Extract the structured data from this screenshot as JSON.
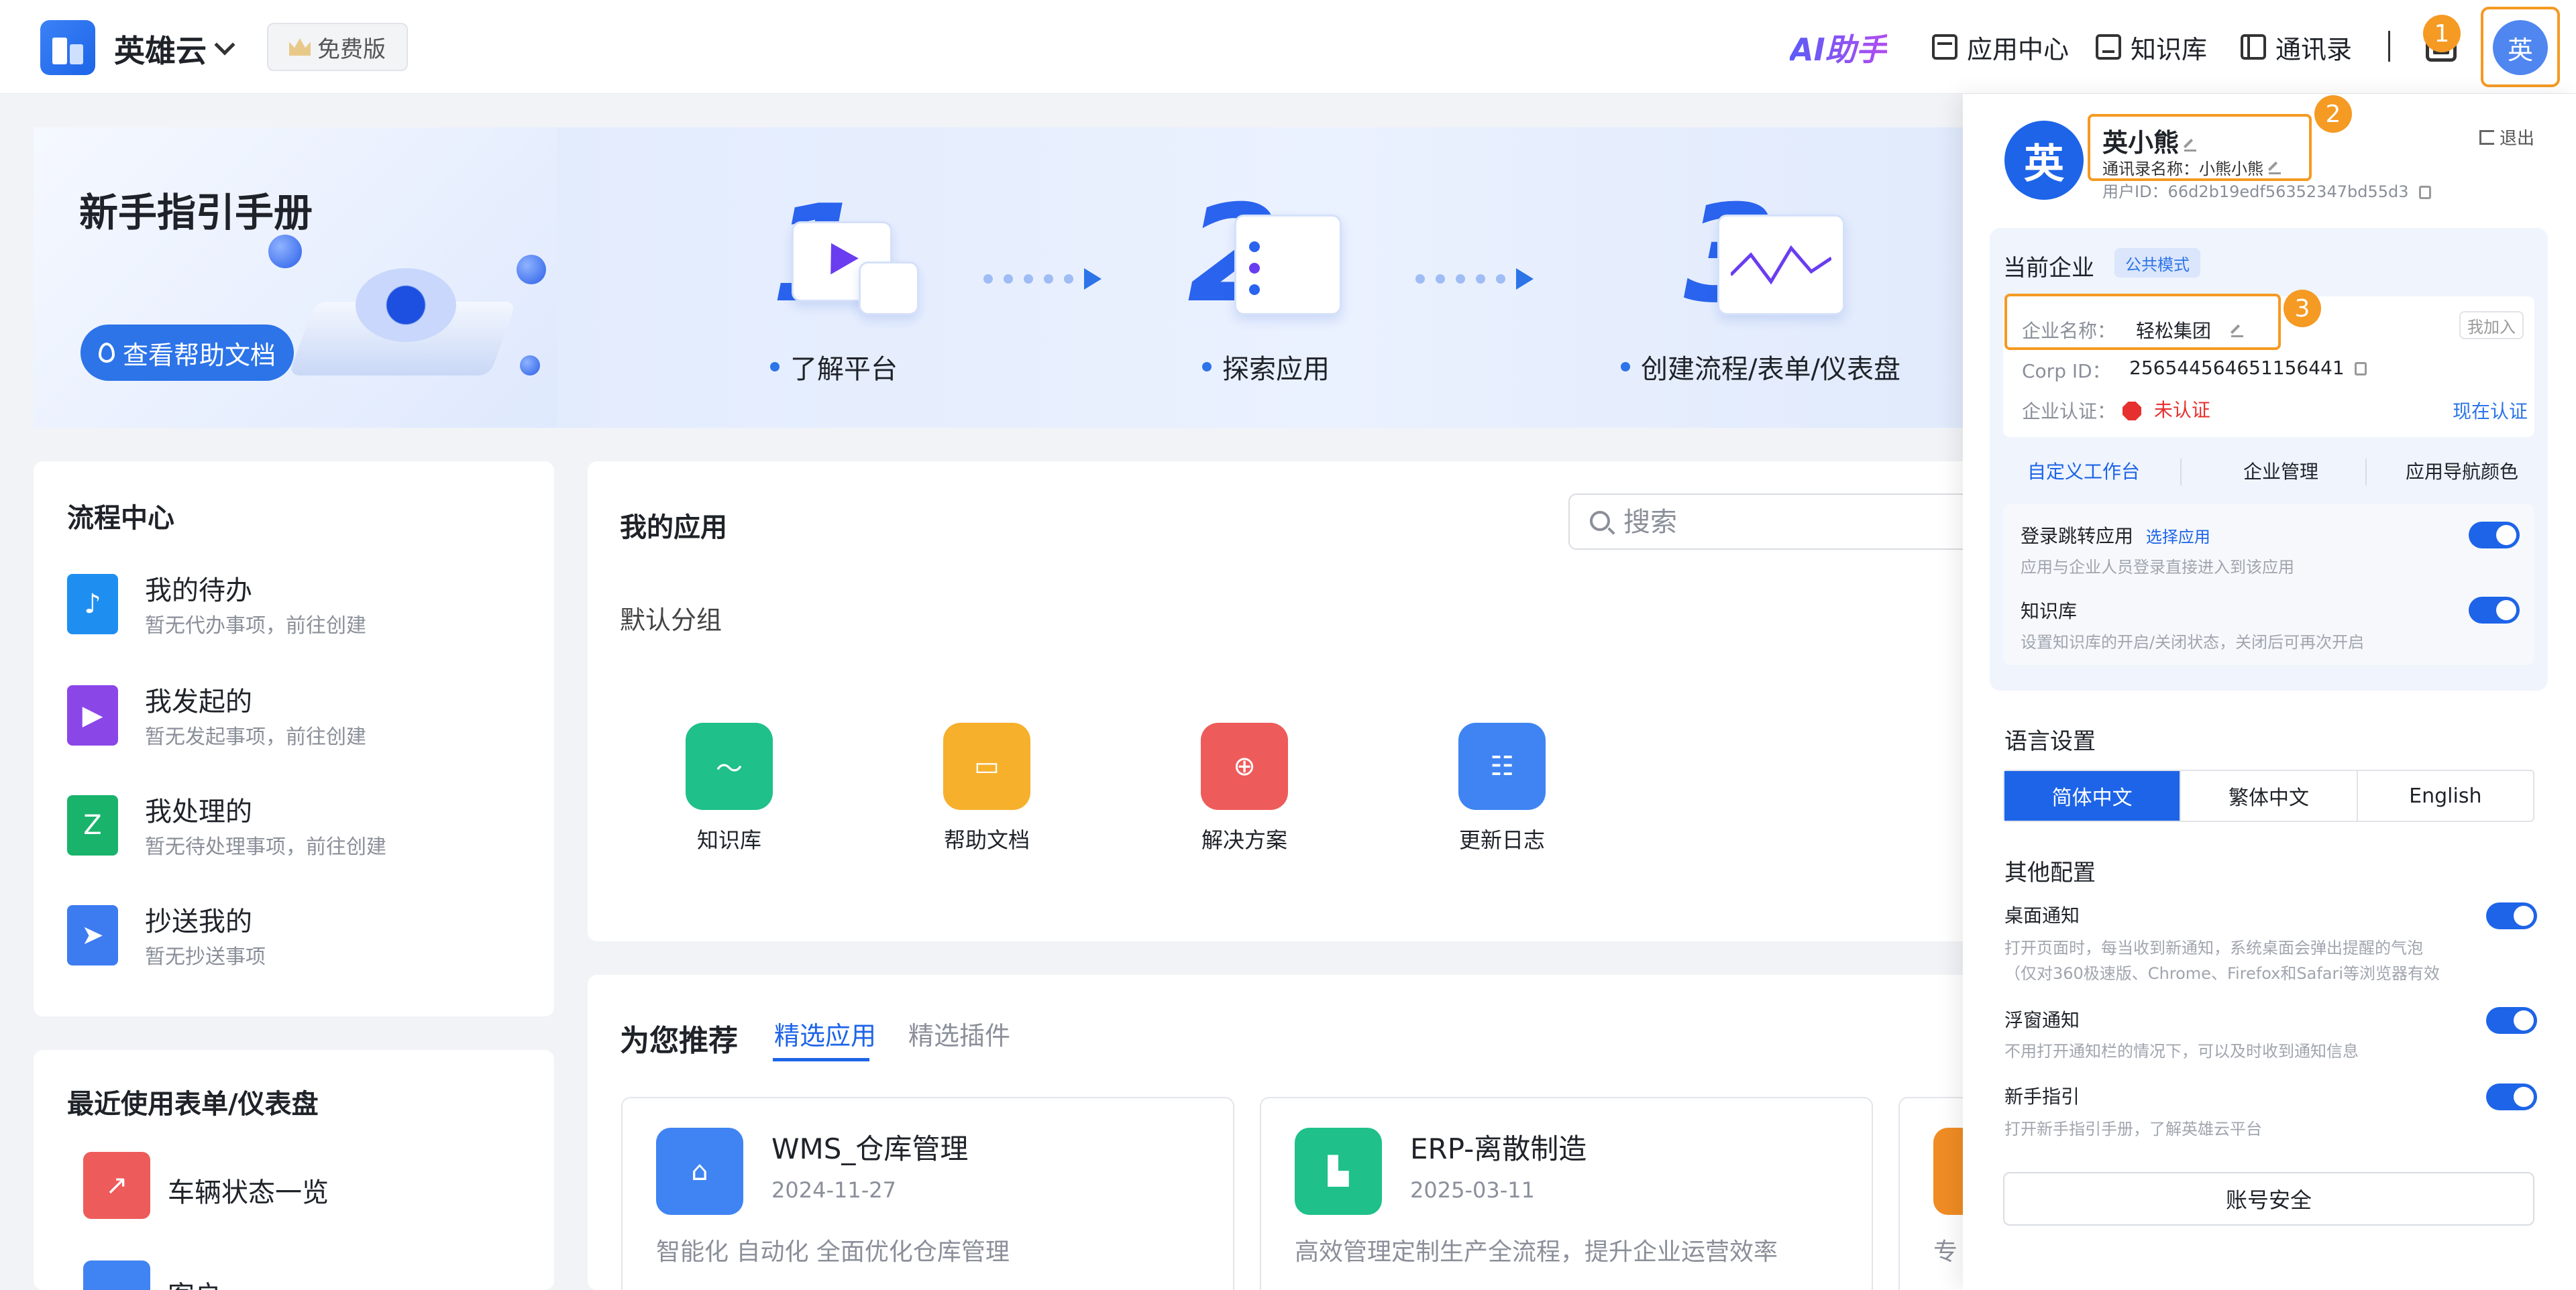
{
  "topbar": {
    "brand": "英雄云",
    "plan": "免费版",
    "ai": "AI助手",
    "nav": [
      "应用中心",
      "知识库",
      "通讯录"
    ],
    "avatar_char": "英",
    "badges": [
      "1",
      "2",
      "3"
    ]
  },
  "banner": {
    "title": "新手指引手册",
    "help_button": "查看帮助文档",
    "steps": [
      "了解平台",
      "探索应用",
      "创建流程/表单/仪表盘"
    ],
    "step_numbers": [
      "1",
      "2",
      "3"
    ]
  },
  "flow": {
    "title": "流程中心",
    "items": [
      {
        "name": "我的待办",
        "sub": "暂无代办事项，前往创建",
        "color": "#1e8ff0"
      },
      {
        "name": "我发起的",
        "sub": "暂无发起事项，前往创建",
        "color": "#8b46e8"
      },
      {
        "name": "我处理的",
        "sub": "暂无待处理事项，前往创建",
        "color": "#19b36b"
      },
      {
        "name": "抄送我的",
        "sub": "暂无抄送事项",
        "color": "#3d7bf0"
      }
    ]
  },
  "recent": {
    "title": "最近使用表单/仪表盘",
    "items": [
      "车辆状态一览",
      "客户"
    ]
  },
  "myapps": {
    "title": "我的应用",
    "search_placeholder": "搜索",
    "group": "默认分组",
    "apps": [
      {
        "name": "知识库",
        "color": "#1fc08a"
      },
      {
        "name": "帮助文档",
        "color": "#f6b02c"
      },
      {
        "name": "解决方案",
        "color": "#ee5b5b"
      },
      {
        "name": "更新日志",
        "color": "#3f84f2"
      }
    ]
  },
  "recommend": {
    "title": "为您推荐",
    "tabs": [
      "精选应用",
      "精选插件"
    ],
    "cards": [
      {
        "name": "WMS_仓库管理",
        "date": "2024-11-27",
        "desc": "智能化 自动化 全面优化仓库管理",
        "color": "#3f84f2"
      },
      {
        "name": "ERP-离散制造",
        "date": "2025-03-11",
        "desc": "高效管理定制生产全流程，提升企业运营效率",
        "color": "#1fc08a"
      },
      {
        "name": "",
        "date": "",
        "desc": "专",
        "color": "#f08c24"
      }
    ]
  },
  "drawer": {
    "avatar_char": "英",
    "name": "英小熊",
    "contact_name": "通讯录名称：小熊小熊",
    "user_id": "用户ID：66d2b19edf56352347bd55d3",
    "logout": "退出",
    "corp": {
      "title": "当前企业",
      "mode": "公共模式",
      "name_label": "企业名称：",
      "name": "轻松集团",
      "join": "我加入",
      "corp_id_label": "Corp ID：",
      "corp_id": "256544564651156441",
      "auth_label": "企业认证：",
      "auth_status": "未认证",
      "auth_link": "现在认证",
      "tabs": [
        "自定义工作台",
        "企业管理",
        "应用导航颜色"
      ],
      "toggles": [
        {
          "label": "登录跳转应用",
          "link": "选择应用",
          "sub": "应用与企业人员登录直接进入到该应用"
        },
        {
          "label": "知识库",
          "link": "",
          "sub": "设置知识库的开启/关闭状态，关闭后可再次开启"
        }
      ]
    },
    "language": {
      "title": "语言设置",
      "options": [
        "简体中文",
        "繁体中文",
        "English"
      ]
    },
    "other": {
      "title": "其他配置",
      "items": [
        {
          "label": "桌面通知",
          "sub1": "打开页面时，每当收到新通知，系统桌面会弹出提醒的气泡",
          "sub2": "（仅对360极速版、Chrome、Firefox和Safari等浏览器有效"
        },
        {
          "label": "浮窗通知",
          "sub1": "不用打开通知栏的情况下，可以及时收到通知信息",
          "sub2": ""
        },
        {
          "label": "新手指引",
          "sub1": "打开新手指引手册，了解英雄云平台",
          "sub2": ""
        }
      ]
    },
    "security_button": "账号安全"
  },
  "colors": {
    "accent": "#1d64e8",
    "highlight": "#f59a23",
    "danger": "#e6302f"
  }
}
